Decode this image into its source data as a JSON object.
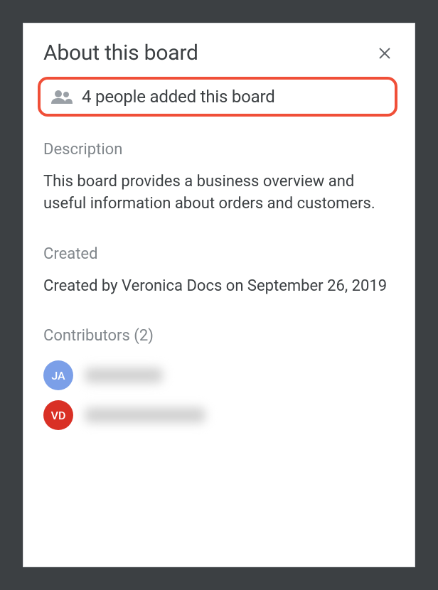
{
  "header": {
    "title": "About this board"
  },
  "highlight": {
    "text": "4 people added this board"
  },
  "sections": {
    "description": {
      "label": "Description",
      "body": "This board provides a business overview and useful information about orders and customers."
    },
    "created": {
      "label": "Created",
      "body": "Created by Veronica Docs on September 26, 2019"
    },
    "contributors": {
      "label": "Contributors (2)",
      "items": [
        {
          "initials": "JA",
          "color": "blue"
        },
        {
          "initials": "VD",
          "color": "red"
        }
      ]
    }
  }
}
